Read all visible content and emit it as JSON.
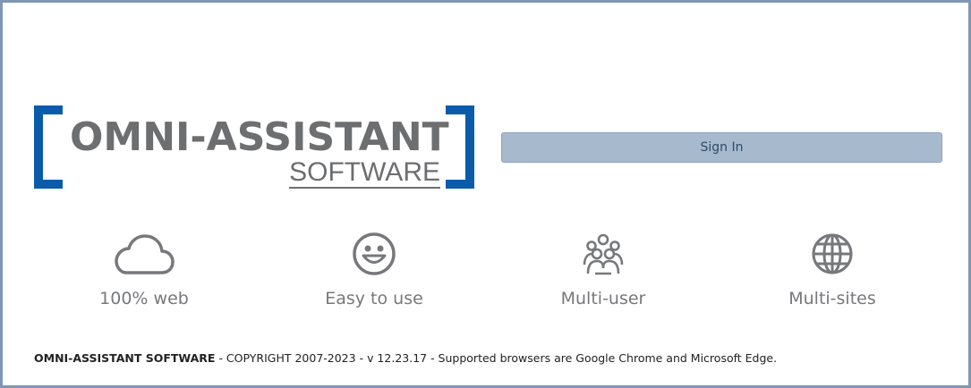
{
  "logo": {
    "main": "OMNI-ASSISTANT",
    "sub": "SOFTWARE",
    "bracket_color": "#0a5caa"
  },
  "signin": {
    "label": "Sign In"
  },
  "features": [
    {
      "label": "100% web",
      "icon": "cloud-icon"
    },
    {
      "label": "Easy to use",
      "icon": "smiley-icon"
    },
    {
      "label": "Multi-user",
      "icon": "users-icon"
    },
    {
      "label": "Multi-sites",
      "icon": "globe-icon"
    }
  ],
  "footer": {
    "brand": "OMNI-ASSISTANT SOFTWARE",
    "copyright": " - COPYRIGHT 2007-2023 - ",
    "version": "v 12.23.17 - Supported browsers are Google Chrome and Microsoft Edge."
  }
}
